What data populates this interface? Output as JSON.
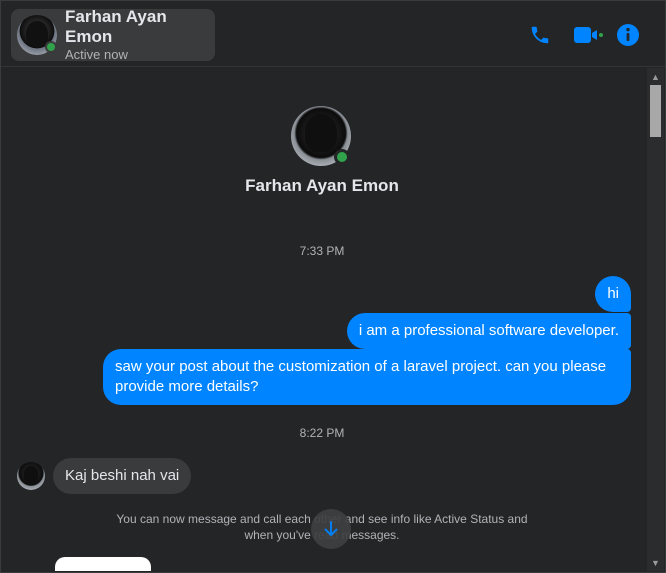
{
  "header": {
    "contact_name": "Farhan Ayan Emon",
    "status": "Active now",
    "actions": [
      {
        "icon": "phone-icon"
      },
      {
        "icon": "video-camera-icon"
      },
      {
        "icon": "info-icon"
      }
    ],
    "accent_color": "#0084ff"
  },
  "profile": {
    "name": "Farhan Ayan Emon"
  },
  "conversation": {
    "groups": [
      {
        "time": "7:33 PM",
        "messages": [
          {
            "from": "me",
            "text": "hi"
          },
          {
            "from": "me",
            "text": "i am a professional software developer."
          },
          {
            "from": "me",
            "text": "saw your post about the customization of a laravel project. can you please provide more details?"
          }
        ]
      },
      {
        "time": "8:22 PM",
        "messages": [
          {
            "from": "them",
            "text": "Kaj beshi nah vai"
          }
        ]
      }
    ],
    "notice": "You can now message and call each other and see info like Active Status and when you've read messages."
  },
  "colors": {
    "background": "#242526",
    "outgoing_bubble": "#0084ff",
    "incoming_bubble": "#3a3b3c",
    "online": "#31a24c"
  }
}
